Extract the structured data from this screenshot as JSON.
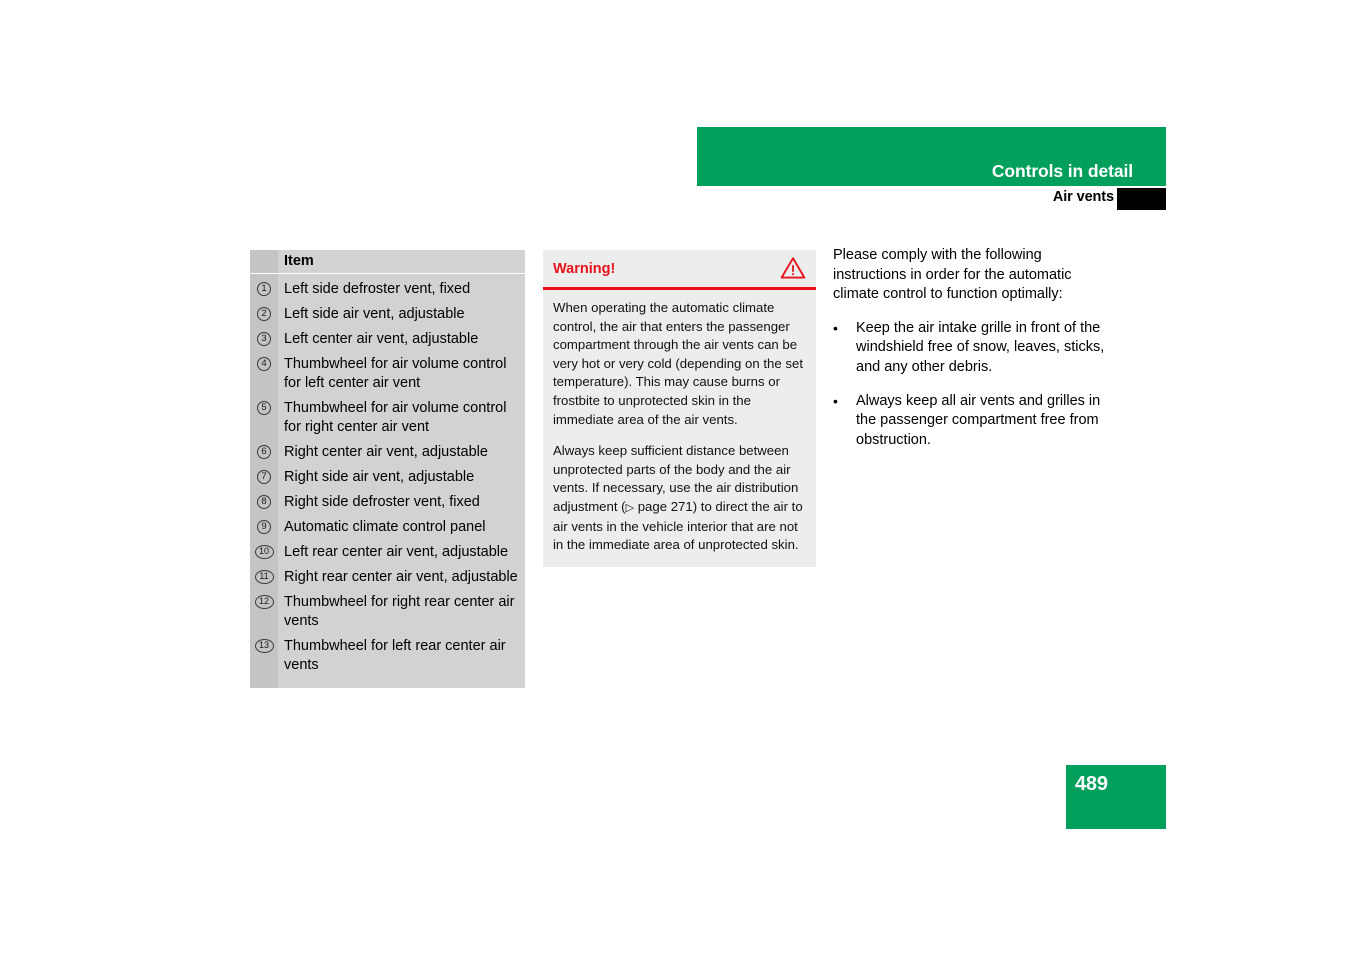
{
  "header": {
    "title": "Controls in detail",
    "subtitle": "Air vents",
    "band_color": "#00a05c",
    "tab_color": "#000000"
  },
  "item_table": {
    "column_header": "Item",
    "rows": [
      {
        "number": "1",
        "label": "Left side defroster vent, fixed"
      },
      {
        "number": "2",
        "label": "Left side air vent, adjustable"
      },
      {
        "number": "3",
        "label": "Left center air vent, adjustable"
      },
      {
        "number": "4",
        "label": "Thumbwheel for air volume control for left center air vent"
      },
      {
        "number": "5",
        "label": "Thumbwheel for air volume control for right center air vent"
      },
      {
        "number": "6",
        "label": "Right center air vent, adjustable"
      },
      {
        "number": "7",
        "label": "Right side air vent, adjustable"
      },
      {
        "number": "8",
        "label": "Right side defroster vent, fixed"
      },
      {
        "number": "9",
        "label": "Automatic climate control panel"
      },
      {
        "number": "10",
        "label": "Left rear center air vent, adjustable"
      },
      {
        "number": "11",
        "label": "Right rear center air vent, adjustable"
      },
      {
        "number": "12",
        "label": "Thumbwheel for right rear center air vents"
      },
      {
        "number": "13",
        "label": "Thumbwheel for left rear center air vents"
      }
    ]
  },
  "warning": {
    "title": "Warning!",
    "icon": "warning-triangle-icon",
    "accent_color": "#e8131b",
    "paragraph_1": "When operating the automatic climate control, the air that enters the passenger compartment through the air vents can be very hot or very cold (depending on the set temperature). This may cause burns or frostbite to unprotected skin in the immediate area of the air vents.",
    "paragraph_2_before_ref": "Always keep sufficient distance between unprotected parts of the body and the air vents. If necessary, use the air distribution adjustment (",
    "reference_marker": "▷",
    "reference_text": " page 271",
    "paragraph_2_after_ref": ") to direct the air to air vents in the vehicle interior that are not in the immediate area of unprotected skin."
  },
  "instructions": {
    "intro": "Please comply with the following instructions in order for the automatic climate control to function optimally:",
    "bullet_marker": "•",
    "bullets": [
      "Keep the air intake grille in front of the windshield free of snow, leaves, sticks, and any other debris.",
      "Always keep all air vents and grilles in the passenger compartment free from obstruction."
    ]
  },
  "footer": {
    "page_number": "489",
    "block_color": "#00a05c"
  }
}
